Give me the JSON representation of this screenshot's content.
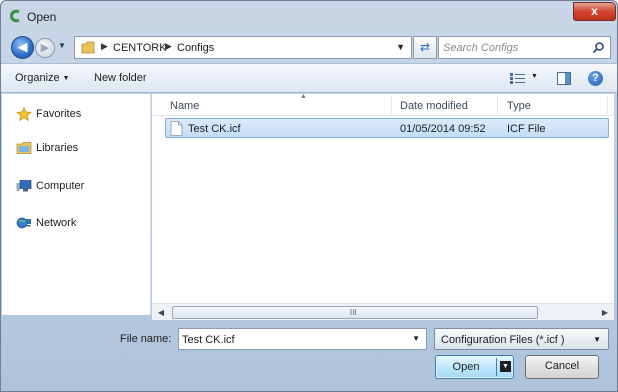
{
  "window": {
    "title": "Open",
    "close_label": "x"
  },
  "nav": {
    "back_icon": "back-arrow-icon",
    "forward_icon": "forward-arrow-icon",
    "address": {
      "segments": [
        "CENTORK",
        "Configs"
      ]
    },
    "search_placeholder": "Search Configs"
  },
  "toolbar": {
    "organize_label": "Organize",
    "new_folder_label": "New folder",
    "help_label": "?"
  },
  "sidebar": {
    "items": [
      {
        "label": "Favorites",
        "icon": "star-icon"
      },
      {
        "label": "Libraries",
        "icon": "libraries-icon"
      },
      {
        "label": "Computer",
        "icon": "computer-icon"
      },
      {
        "label": "Network",
        "icon": "network-icon"
      }
    ]
  },
  "file_list": {
    "columns": [
      "Name",
      "Date modified",
      "Type"
    ],
    "rows": [
      {
        "name": "Test CK.icf",
        "date": "01/05/2014 09:52",
        "type": "ICF File"
      }
    ]
  },
  "scrollbar": {
    "grip": "III"
  },
  "footer": {
    "file_name_label": "File name:",
    "file_name_value": "Test CK.icf",
    "file_type": "Configuration Files (*.icf )",
    "open_label": "Open",
    "cancel_label": "Cancel"
  },
  "colors": {
    "selection": "#cce4fa",
    "frame": "#b9cbe0",
    "accent": "#2b6cc4"
  }
}
